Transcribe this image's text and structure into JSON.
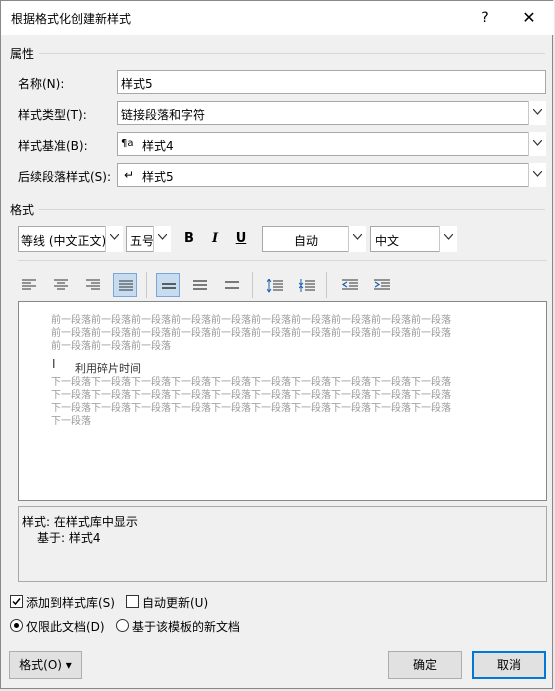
{
  "window": {
    "title": "根据格式化创建新样式",
    "help_label": "?",
    "close_label": "✕"
  },
  "properties": {
    "section_label": "属性",
    "name_label": "名称(N):",
    "name_value": "样式5",
    "type_label": "样式类型(T):",
    "type_value": "链接段落和字符",
    "based_label": "样式基准(B):",
    "based_icon": "¶a",
    "based_value": "样式4",
    "following_label": "后续段落样式(S):",
    "following_icon": "↵",
    "following_value": "样式5"
  },
  "format": {
    "section_label": "格式",
    "font": "等线 (中文正文)",
    "size": "五号",
    "bold": "B",
    "italic": "I",
    "underline": "U",
    "color": "自动",
    "script": "中文"
  },
  "preview": {
    "prev_lines": [
      "前一段落前一段落前一段落前一段落前一段落前一段落前一段落前一段落前一段落前一段落",
      "前一段落前一段落前一段落前一段落前一段落前一段落前一段落前一段落前一段落前一段落",
      "前一段落前一段落前一段落"
    ],
    "sample_text": "利用碎片时间",
    "cursor": "I",
    "next_lines": [
      "下一段落下一段落下一段落下一段落下一段落下一段落下一段落下一段落下一段落下一段落",
      "下一段落下一段落下一段落下一段落下一段落下一段落下一段落下一段落下一段落下一段落",
      "下一段落下一段落下一段落下一段落下一段落下一段落下一段落下一段落下一段落下一段落",
      "下一段落"
    ]
  },
  "description": {
    "line1": "样式: 在样式库中显示",
    "line2": "基于: 样式4"
  },
  "options": {
    "add_to_gallery": "添加到样式库(S)",
    "add_to_gallery_checked": true,
    "auto_update": "自动更新(U)",
    "auto_update_checked": false,
    "only_this_doc": "仅限此文档(D)",
    "new_docs_template": "基于该模板的新文档"
  },
  "buttons": {
    "format_menu": "格式(O) ▾",
    "ok": "确定",
    "cancel": "取消"
  }
}
